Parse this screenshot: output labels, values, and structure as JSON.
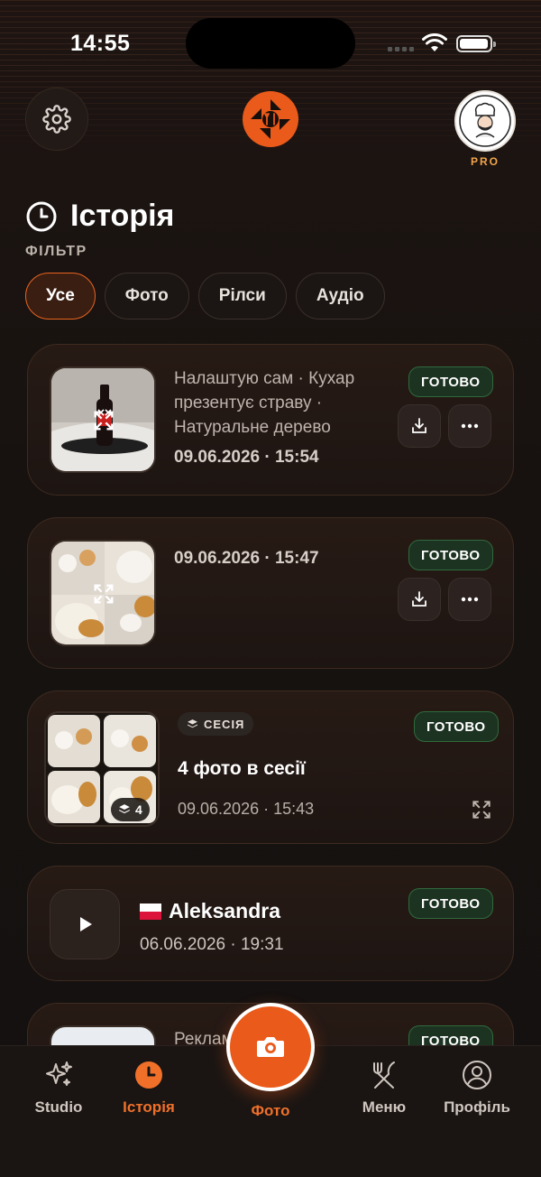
{
  "status_bar": {
    "time": "14:55"
  },
  "header": {
    "badge": "PRO"
  },
  "history": {
    "title": "Історія",
    "filter_label": "ФІЛЬТР",
    "filters": [
      {
        "label": "Усе",
        "active": true
      },
      {
        "label": "Фото",
        "active": false
      },
      {
        "label": "Рілси",
        "active": false
      },
      {
        "label": "Аудіо",
        "active": false
      }
    ]
  },
  "items": [
    {
      "type": "photo",
      "description": "Налаштую сам · Кухар презентує страву · Натуральне дерево",
      "datetime": "09.06.2026 · 15:54",
      "status": "ГОТОВО"
    },
    {
      "type": "photo",
      "datetime": "09.06.2026 · 15:47",
      "status": "ГОТОВО"
    },
    {
      "type": "session",
      "session_label": "СЕСІЯ",
      "title": "4 фото в сесії",
      "count": "4",
      "datetime": "09.06.2026 · 15:43",
      "status": "ГОТОВО"
    },
    {
      "type": "audio",
      "name": "Aleksandra",
      "datetime": "06.06.2026 · 19:31",
      "status": "ГОТОВО"
    },
    {
      "type": "reel",
      "description": "Рекламний ролик",
      "status": "ГОТОВО"
    }
  ],
  "tabbar": {
    "studio": "Studio",
    "history": "Історія",
    "photo": "Фото",
    "menu": "Меню",
    "profile": "Профіль"
  },
  "colors": {
    "accent": "#ea5a1a",
    "success": "#2f6a3c",
    "background": "#151110"
  }
}
